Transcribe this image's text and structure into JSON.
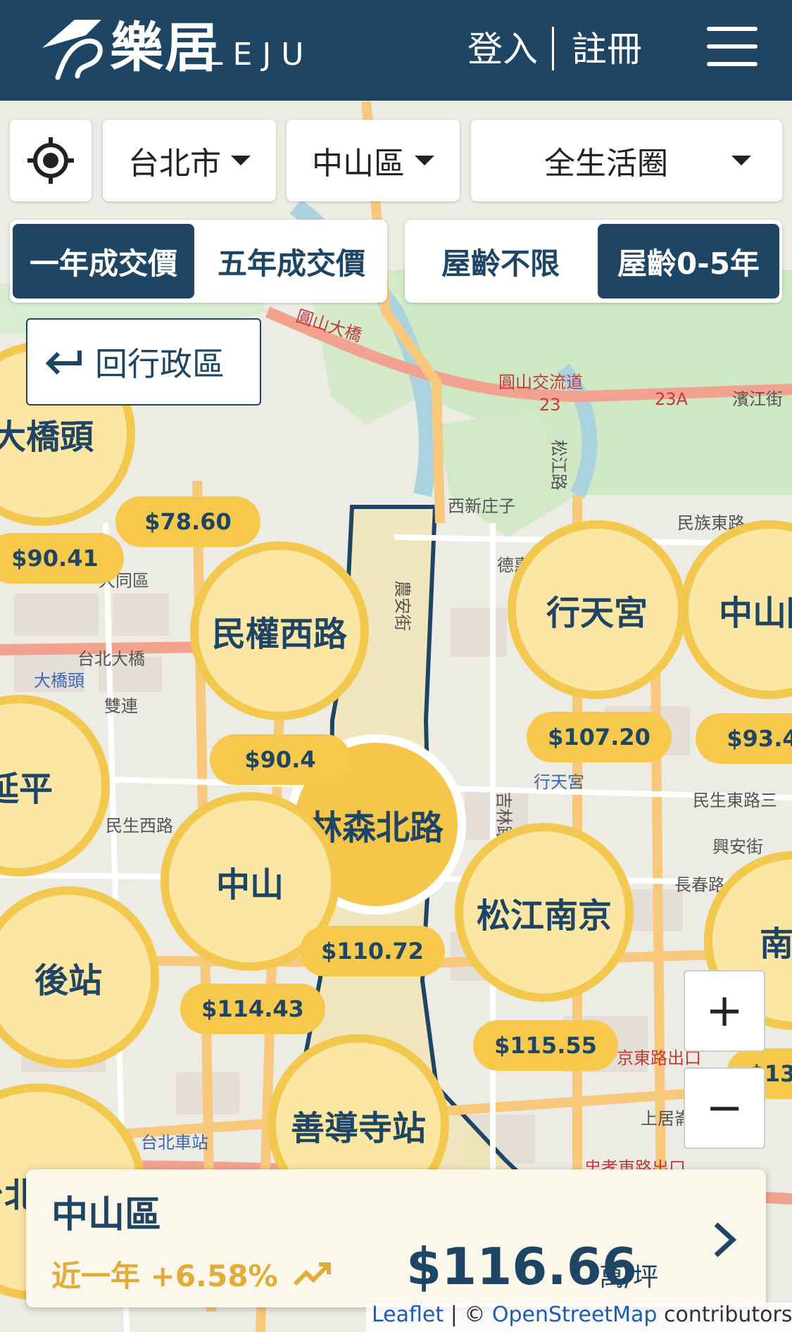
{
  "header": {
    "logo_text": "樂居",
    "logo_sub": "LEJU",
    "login": "登入",
    "register": "註冊",
    "menu_icon": "hamburger-menu-icon"
  },
  "filters": {
    "locate_icon": "crosshair-locate-icon",
    "city": "台北市",
    "district": "中山區",
    "area": "全生活圈"
  },
  "toggles": {
    "period_1y": "一年成交價",
    "period_5y": "五年成交價",
    "age_any": "屋齡不限",
    "age_0_5": "屋齡0-5年"
  },
  "back_button": {
    "icon": "return-arrow-icon",
    "label": "回行政區"
  },
  "clusters": [
    {
      "name": "大橋頭"
    },
    {
      "name": "民權西路"
    },
    {
      "name": "行天宮"
    },
    {
      "name": "中山國"
    },
    {
      "name": "延平"
    },
    {
      "name": "林森北路"
    },
    {
      "name": "中山"
    },
    {
      "name": "松江南京"
    },
    {
      "name": "南京"
    },
    {
      "name": "後站"
    },
    {
      "name": "善導寺站"
    },
    {
      "name": "台北車站"
    }
  ],
  "prices": [
    {
      "value": "$78.60"
    },
    {
      "value": "$90.41"
    },
    {
      "value": "$107.20"
    },
    {
      "value": "$93.4"
    },
    {
      "value": "$90.4"
    },
    {
      "value": "$110.72"
    },
    {
      "value": "$114.43"
    },
    {
      "value": "$115.55"
    },
    {
      "value": "$13"
    }
  ],
  "map_labels": [
    {
      "text": "圓山大橋"
    },
    {
      "text": "圓山交流道"
    },
    {
      "text": "23"
    },
    {
      "text": "23A"
    },
    {
      "text": "濱江街"
    },
    {
      "text": "西新庄子"
    },
    {
      "text": "民族東路"
    },
    {
      "text": "大同區"
    },
    {
      "text": "台北大橋"
    },
    {
      "text": "大橋頭"
    },
    {
      "text": "雙連"
    },
    {
      "text": "民生西路"
    },
    {
      "text": "行天宮"
    },
    {
      "text": "民生東路三"
    },
    {
      "text": "興安街"
    },
    {
      "text": "長春路"
    },
    {
      "text": "上居崙"
    },
    {
      "text": "台北車站"
    },
    {
      "text": "忠孝東路出口"
    },
    {
      "text": "京東路出口"
    },
    {
      "text": "農安街"
    },
    {
      "text": "德惠街"
    },
    {
      "text": "吉林路"
    },
    {
      "text": "松江路"
    }
  ],
  "zoom": {
    "in": "+",
    "out": "−"
  },
  "summary_card": {
    "district": "中山區",
    "trend_label": "近一年 +6.58%",
    "trend_icon": "trending-up-icon",
    "price": "$116.66",
    "unit": "萬/坪",
    "chevron_icon": "chevron-right-icon"
  },
  "attribution": {
    "leaflet": "Leaflet",
    "sep": " | © ",
    "osm": "OpenStreetMap",
    "suffix": " contributors"
  },
  "colors": {
    "brand_navy": "#1f4565",
    "cluster_fill": "#fbe6a3",
    "cluster_border": "#f3c84f",
    "price_tag": "#f6c84c",
    "trend_gold": "#e2ac3b"
  }
}
